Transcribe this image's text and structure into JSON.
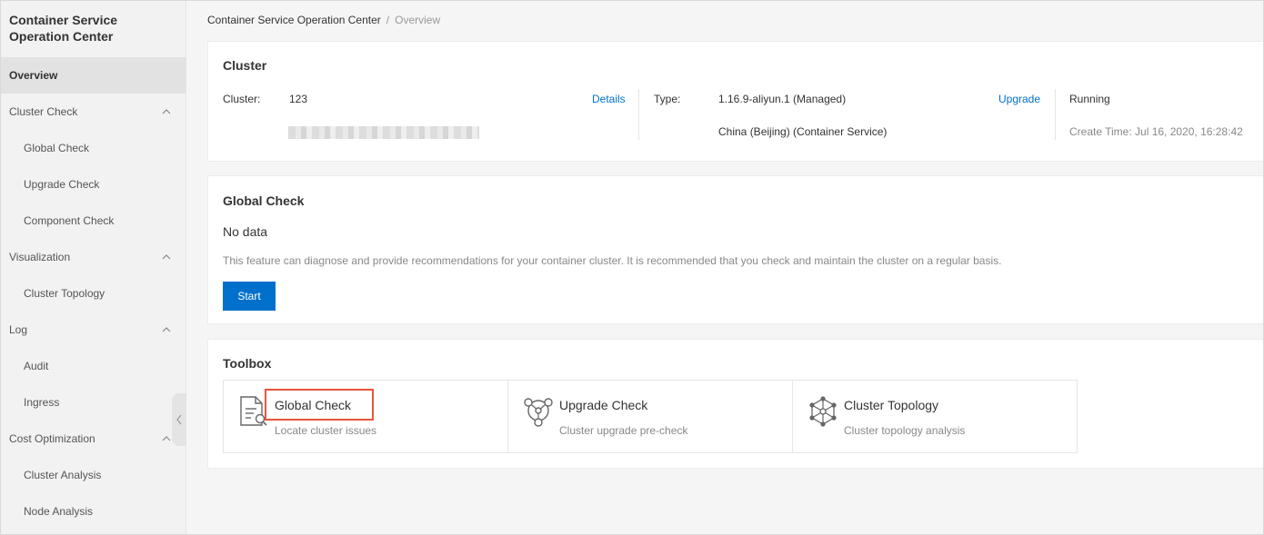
{
  "sidebar": {
    "title_line1": "Container Service",
    "title_line2": "Operation Center",
    "items": [
      {
        "label": "Overview"
      },
      {
        "label": "Cluster Check"
      },
      {
        "label": "Global Check"
      },
      {
        "label": "Upgrade Check"
      },
      {
        "label": "Component Check"
      },
      {
        "label": "Visualization"
      },
      {
        "label": "Cluster Topology"
      },
      {
        "label": "Log"
      },
      {
        "label": "Audit"
      },
      {
        "label": "Ingress"
      },
      {
        "label": "Cost Optimization"
      },
      {
        "label": "Cluster Analysis"
      },
      {
        "label": "Node Analysis"
      }
    ]
  },
  "breadcrumb": {
    "root": "Container Service Operation Center",
    "sep": "/",
    "current": "Overview"
  },
  "cluster_card": {
    "title": "Cluster",
    "cluster_label": "Cluster:",
    "cluster_value": "123",
    "details_link": "Details",
    "type_label": "Type:",
    "type_value": "1.16.9-aliyun.1 (Managed)",
    "upgrade_link": "Upgrade",
    "region_value": "China (Beijing) (Container Service)",
    "status": "Running",
    "create_time": "Create Time: Jul 16, 2020, 16:28:42"
  },
  "global_check_card": {
    "title": "Global Check",
    "empty_text": "No data",
    "description": "This feature can diagnose and provide recommendations for your container cluster. It is recommended that you check and maintain the cluster on a regular basis.",
    "start_button": "Start"
  },
  "toolbox": {
    "title": "Toolbox",
    "tools": [
      {
        "name": "Global Check",
        "desc": "Locate cluster issues",
        "icon": "document-search-icon"
      },
      {
        "name": "Upgrade Check",
        "desc": "Cluster upgrade pre-check",
        "icon": "upgrade-nodes-icon"
      },
      {
        "name": "Cluster Topology",
        "desc": "Cluster topology analysis",
        "icon": "topology-icon"
      }
    ]
  },
  "colors": {
    "accent": "#0070cc",
    "highlight": "#e8563a"
  }
}
